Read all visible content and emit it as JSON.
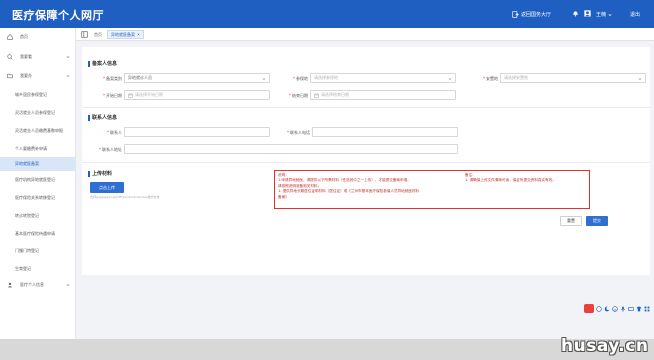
{
  "header": {
    "title": "医疗保障个人网厅",
    "return_home": "返回国务大厅",
    "user_name": "王楠",
    "logout": "退出"
  },
  "sidebar": {
    "items": [
      {
        "label": "首页",
        "icon": "home-icon"
      },
      {
        "label": "我要看",
        "icon": "search-icon"
      },
      {
        "label": "我要办",
        "icon": "folder-icon"
      },
      {
        "label": "城乡居民参保登记"
      },
      {
        "label": "灵活就业人员参保登记"
      },
      {
        "label": "灵活就业人员缴费基数申报"
      },
      {
        "label": "个人要缴费补申请"
      },
      {
        "label": "异地就医备案"
      },
      {
        "label": "医疗机构异地就医登记"
      },
      {
        "label": "医疗保险关系转移登记"
      },
      {
        "label": "转诊转院登记"
      },
      {
        "label": "基本医疗保险待遇申请"
      },
      {
        "label": "门慢门特登记"
      },
      {
        "label": "生育登记"
      },
      {
        "label": "医疗个人信息",
        "icon": "user-icon"
      }
    ]
  },
  "tabs": {
    "home": "首页",
    "current": "异地就医备案"
  },
  "form": {
    "section1_title": "备案人信息",
    "filing_type_label": "备案类别",
    "filing_type_value": "异地就诊人员",
    "insured_place_label": "参保地",
    "insured_place_ph": "请选择参保地",
    "settle_place_label": "安置地",
    "settle_place_ph": "请选择安置地",
    "start_date_label": "开始日期",
    "start_date_ph": "请选择开始日期",
    "end_date_label": "结束日期",
    "end_date_ph": "请选择结束日期",
    "section2_title": "联系人信息",
    "contact_name_label": "联系人",
    "contact_phone_label": "联系人电话",
    "contact_address_label": "联系人地址",
    "section3_title": "上传材料",
    "upload_button": "点击上传",
    "upload_hint": "支持jpg/jpeg/png/pdf/doc/docx/xls/xlsx格式文件",
    "notice_left": [
      "说明：",
      "1.申请异地就医，请提供以下所需材料（任选其中之一上传），才能提交备案申请。",
      "请参照说明准备相关材料；",
      "1. 提供异地长期居住证明材料（居住证）或《兰州市基本医疗保险参保人员异地就医材料",
      "备案》"
    ],
    "notice_right": [
      "备注：",
      "1. 请确保上传文件清晰可读，保证所提交资料真实有效。"
    ],
    "reset_button": "重置",
    "submit_button": "提交"
  },
  "watermark": "husay.cn"
}
